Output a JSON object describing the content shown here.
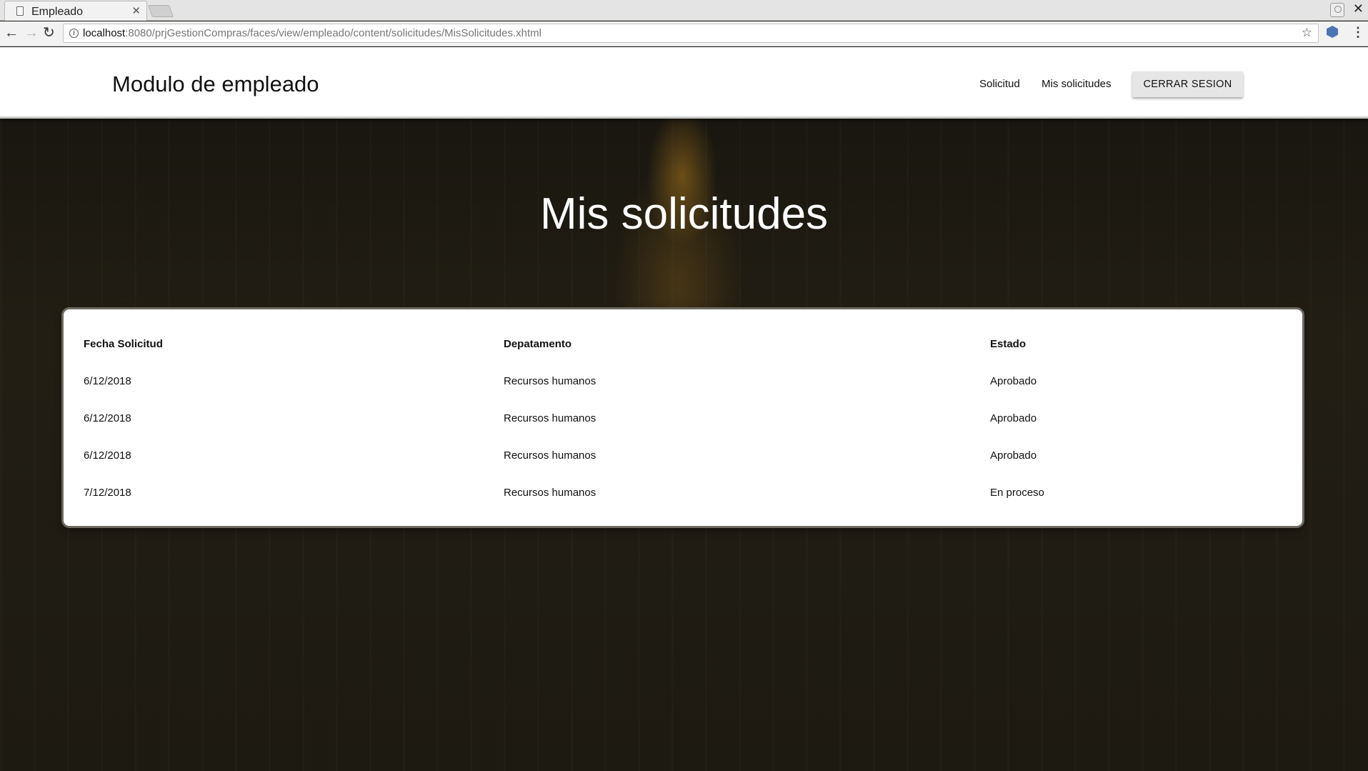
{
  "browser": {
    "tab_title": "Empleado",
    "url_host": "localhost",
    "url_rest": ":8080/prjGestionCompras/faces/view/empleado/content/solicitudes/MisSolicitudes.xhtml"
  },
  "header": {
    "brand": "Modulo de empleado",
    "nav": [
      "Solicitud",
      "Mis solicitudes"
    ],
    "logout_label": "CERRAR SESION"
  },
  "main": {
    "title": "Mis solicitudes",
    "table": {
      "columns": [
        "Fecha Solicitud",
        "Depatamento",
        "Estado"
      ],
      "rows": [
        [
          "6/12/2018",
          "Recursos humanos",
          "Aprobado"
        ],
        [
          "6/12/2018",
          "Recursos humanos",
          "Aprobado"
        ],
        [
          "6/12/2018",
          "Recursos humanos",
          "Aprobado"
        ],
        [
          "7/12/2018",
          "Recursos humanos",
          "En proceso"
        ]
      ]
    }
  }
}
